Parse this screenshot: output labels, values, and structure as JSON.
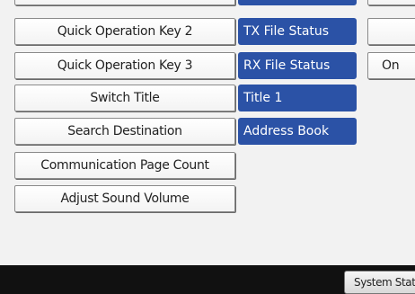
{
  "settings": {
    "rows": [
      {
        "label": "Quick Operation Key 2",
        "value": "TX File Status",
        "extra": ""
      },
      {
        "label": "Quick Operation Key 3",
        "value": "RX File Status",
        "extra": "On"
      },
      {
        "label": "Switch Title",
        "value": "Title 1"
      },
      {
        "label": "Search Destination",
        "value": "Address Book"
      },
      {
        "label": "Communication Page Count"
      },
      {
        "label": "Adjust Sound Volume"
      }
    ]
  },
  "footer": {
    "system_status_label": "System Status"
  },
  "colors": {
    "value_bg": "#2b52a6",
    "footer_bg": "#111111"
  }
}
